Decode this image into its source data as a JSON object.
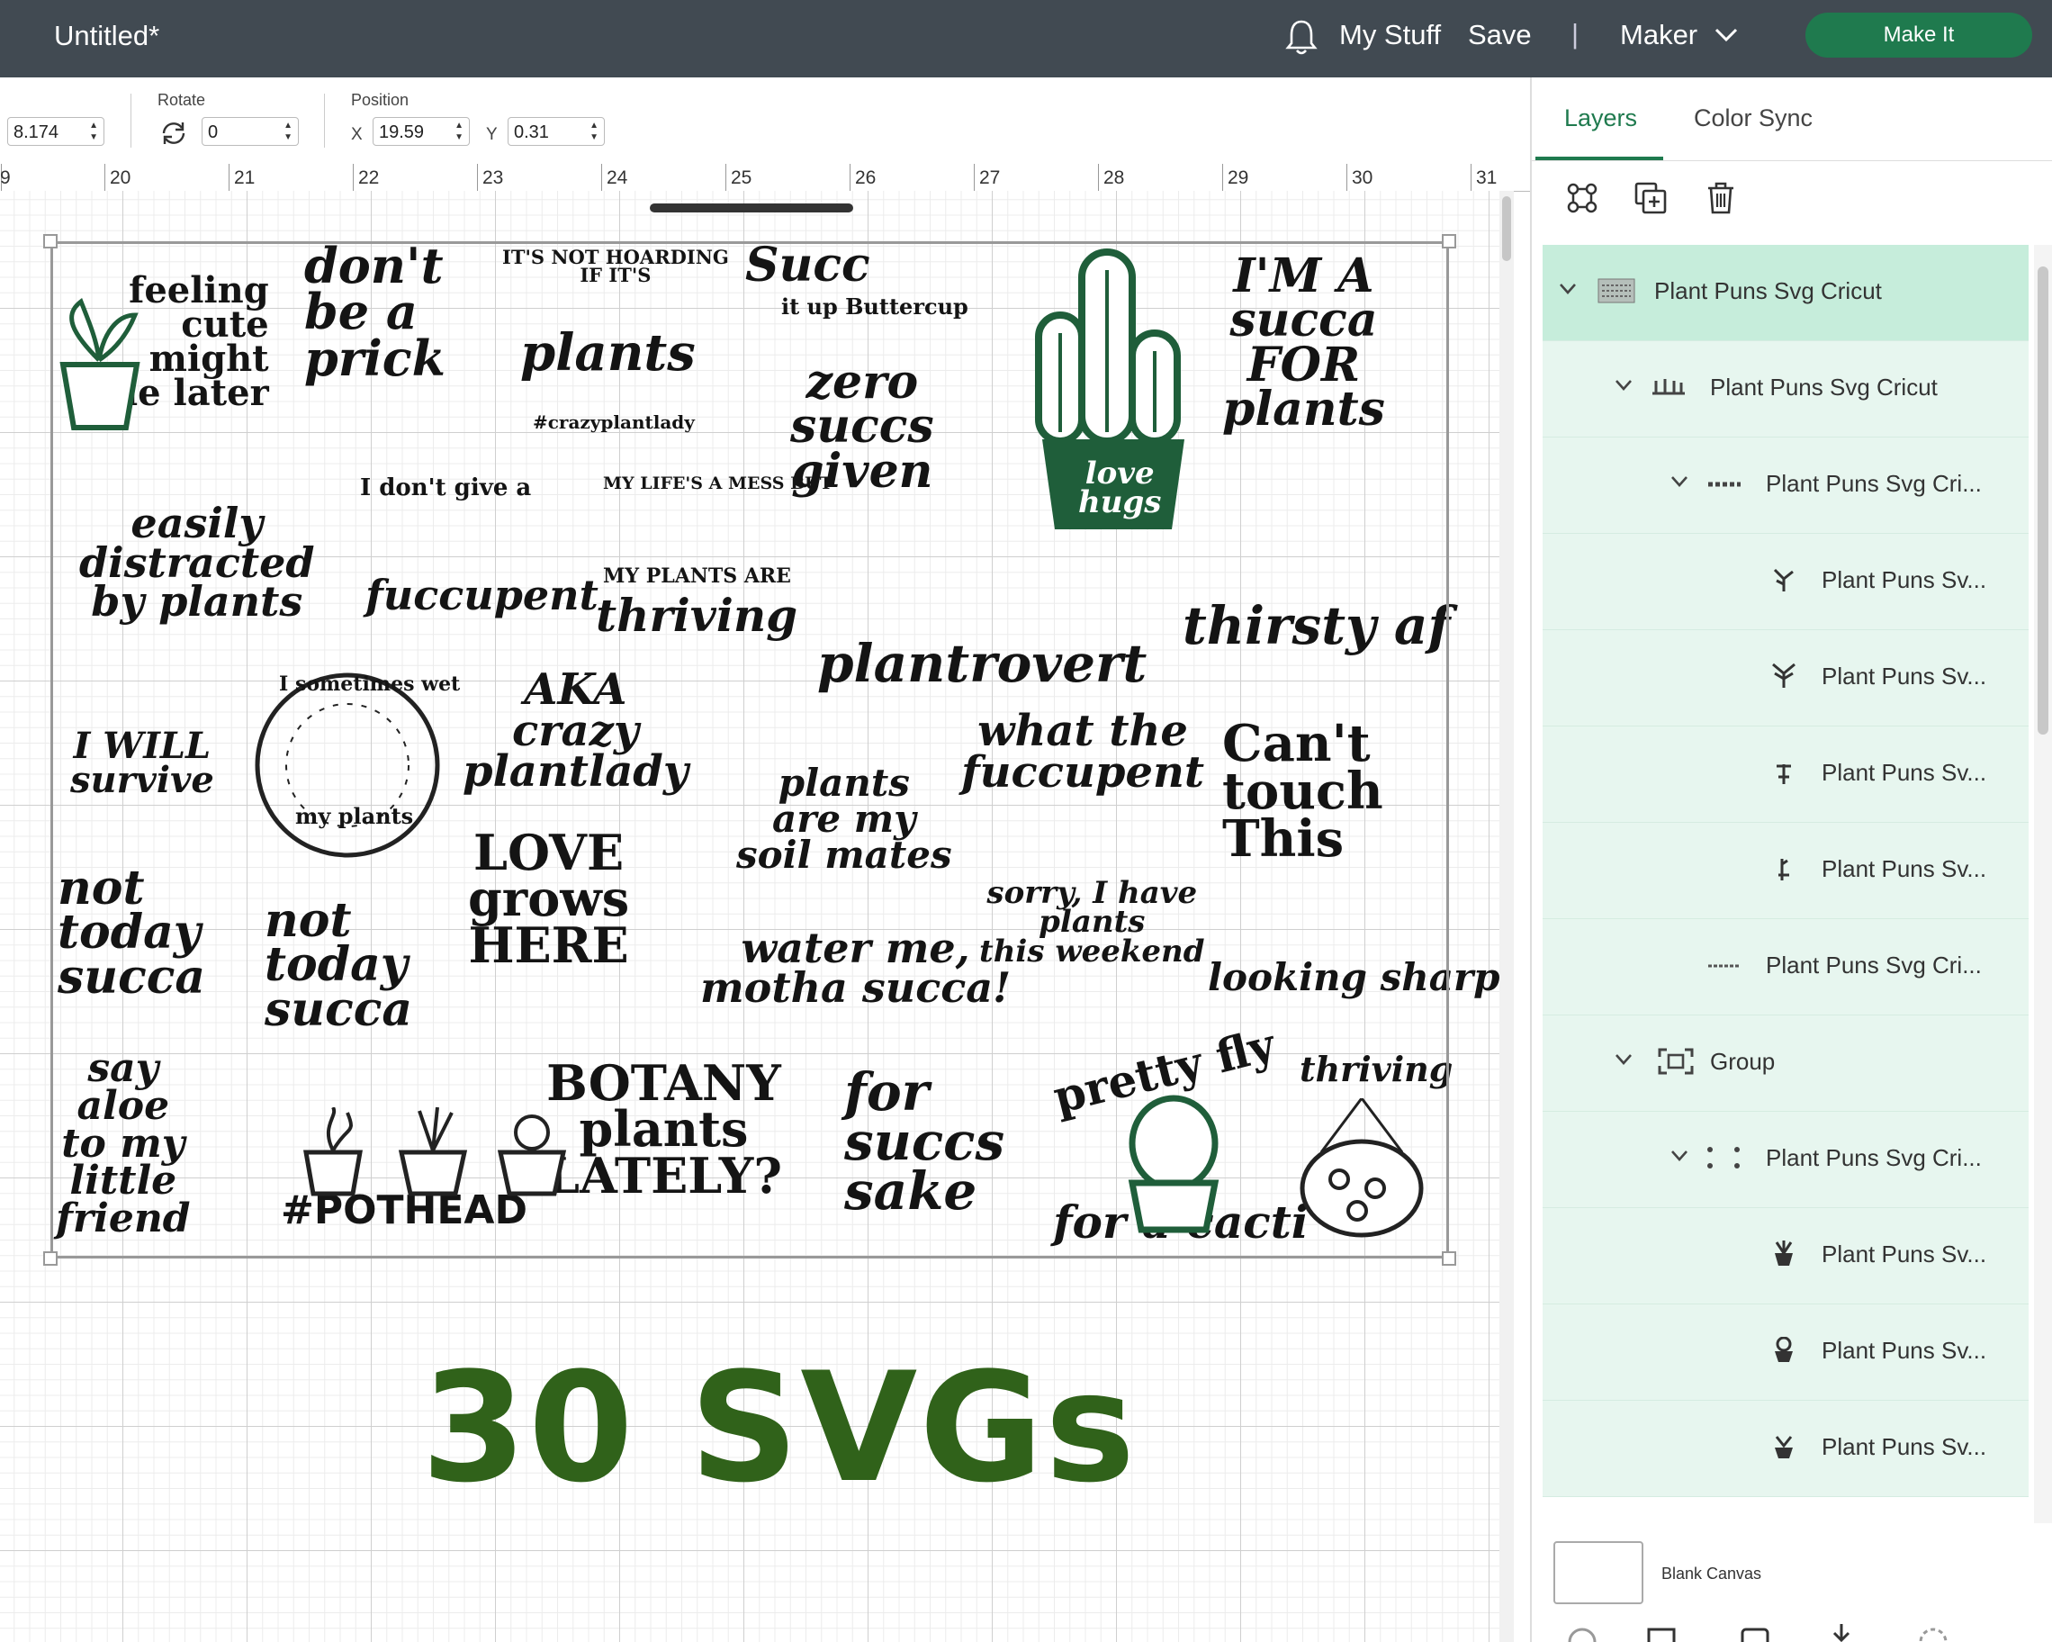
{
  "header": {
    "title": "Untitled*",
    "my_stuff": "My Stuff",
    "save": "Save",
    "separator": "|",
    "machine": "Maker",
    "make_it": "Make It"
  },
  "toolbar": {
    "size_value": "8.174",
    "rotate_label": "Rotate",
    "rotate_value": "0",
    "position_label": "Position",
    "x_label": "X",
    "x_value": "19.59",
    "y_label": "Y",
    "y_value": "0.31"
  },
  "ruler": [
    "9",
    "20",
    "21",
    "22",
    "23",
    "24",
    "25",
    "26",
    "27",
    "28",
    "29",
    "30",
    "31"
  ],
  "artboard": {
    "phrases": [
      "feeling\ncute\nmight\ndie later",
      "don't\nbe a\nprick",
      "IT'S NOT HOARDING\nIF IT'S",
      "plants",
      "#crazyplantlady",
      "Succ",
      "it up Buttercup",
      "zero\nsuccs\ngiven",
      "I'M A\nsucca\nFOR\nplants",
      "easily\ndistracted\nby plants",
      "I don't give a",
      "fuccupent",
      "MY LIFE'S A MESS BUT",
      "MY PLANTS ARE",
      "thriving",
      "plantrovert",
      "thirsty af",
      "I WILL\nsurvive",
      "I sometimes wet",
      "my plants",
      "AKA\ncrazy\nplantlady",
      "plants\nare my\nsoil mates",
      "what the\nfuccupent",
      "Can't\ntouch\nThis",
      "not\ntoday\nsucca",
      "not\ntoday\nsucca",
      "LOVE\ngrows\nHERE",
      "water me,\nmotha succa!",
      "sorry, I have\nplants\nthis weekend",
      "looking sharp",
      "say\naloe\nto my\nlittle\nfriend",
      "#POTHEAD",
      "BOTANY\nplants\nLATELY?",
      "for\nsuccs\nsake",
      "pretty fly",
      "for a cacti",
      "thriving",
      "love\nhugs"
    ]
  },
  "overlay_text": "30 SVGs",
  "panel": {
    "tabs": [
      "Layers",
      "Color Sync"
    ],
    "layers": [
      {
        "label": "Plant Puns Svg Cricut"
      },
      {
        "label": "Plant Puns Svg Cricut"
      },
      {
        "label": "Plant Puns Svg Cri..."
      },
      {
        "label": "Plant Puns Sv..."
      },
      {
        "label": "Plant Puns Sv..."
      },
      {
        "label": "Plant Puns Sv..."
      },
      {
        "label": "Plant Puns Sv..."
      },
      {
        "label": "Plant Puns Svg Cri..."
      },
      {
        "label": "Group"
      },
      {
        "label": "Plant Puns Svg Cri..."
      },
      {
        "label": "Plant Puns Sv..."
      },
      {
        "label": "Plant Puns Sv..."
      },
      {
        "label": "Plant Puns Sv..."
      }
    ],
    "blank_canvas": "Blank Canvas"
  },
  "colors": {
    "header_bg": "#414a52",
    "accent": "#1f7a4e",
    "overlay_text": "#30621a",
    "layer_bg": "#e7f6ef",
    "layer_selected_bg": "#c6eddb"
  }
}
